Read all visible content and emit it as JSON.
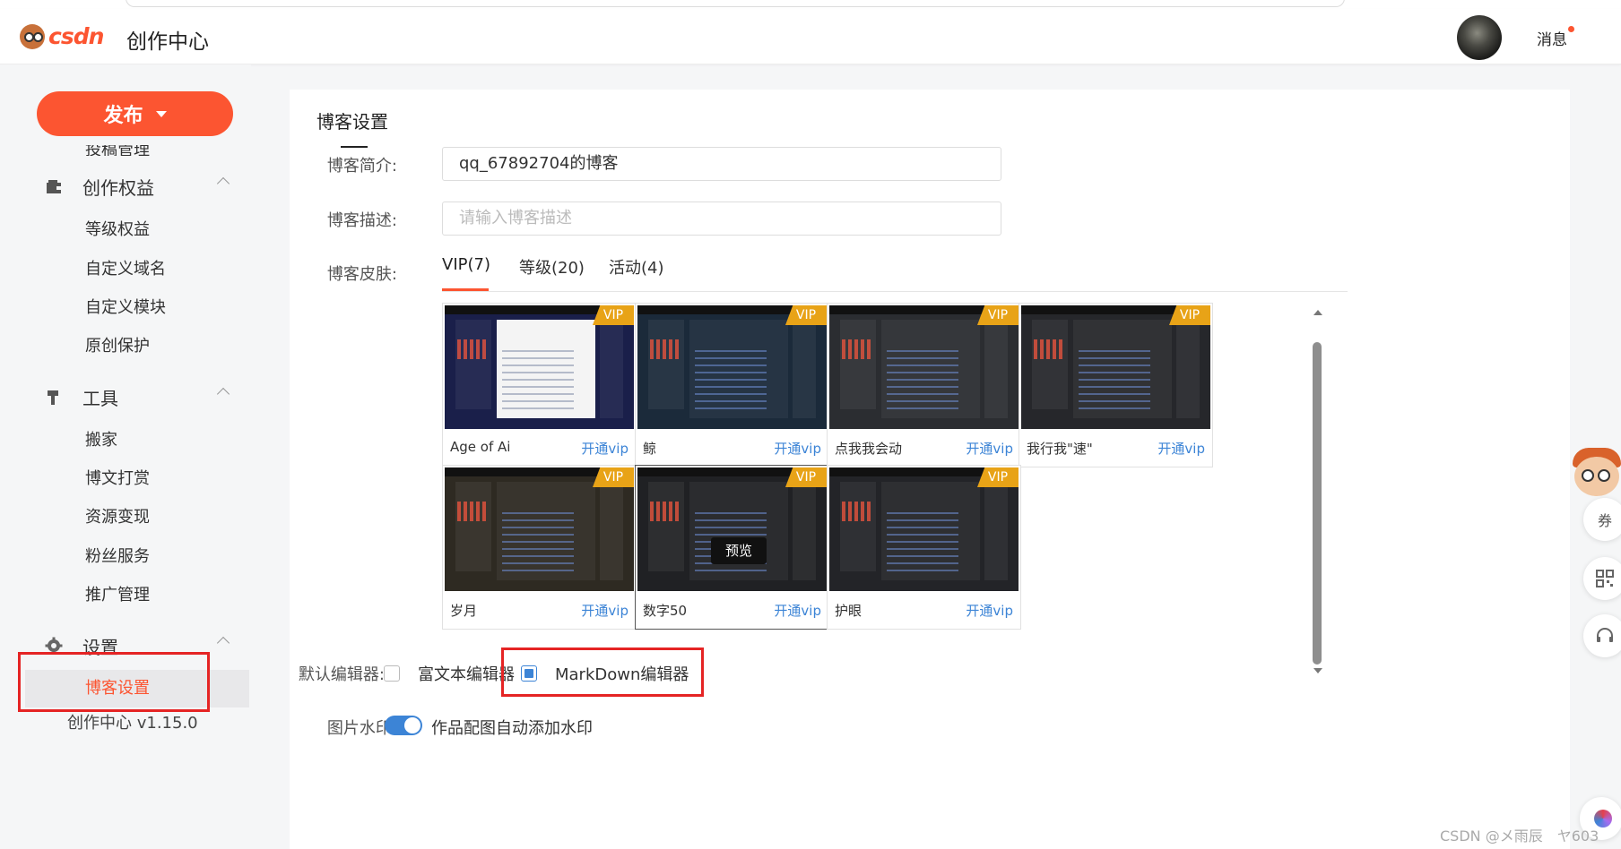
{
  "header": {
    "logo_text": "csdn",
    "title": "创作中心",
    "messages_label": "消息"
  },
  "sidebar": {
    "publish_label": "发布",
    "cut_item": "投稿管理",
    "groups": [
      {
        "title": "创作权益",
        "icon": "wallet-icon",
        "items": [
          "等级权益",
          "自定义域名",
          "自定义模块",
          "原创保护"
        ]
      },
      {
        "title": "工具",
        "icon": "tool-icon",
        "items": [
          "搬家",
          "博文打赏",
          "资源变现",
          "粉丝服务",
          "推广管理"
        ]
      },
      {
        "title": "设置",
        "icon": "gear-icon",
        "items": [
          "博客设置"
        ]
      }
    ],
    "active_item": "博客设置",
    "version": "创作中心 v1.15.0"
  },
  "panel": {
    "title": "博客设置",
    "intro_label": "博客简介:",
    "intro_value": "qq_67892704的博客",
    "desc_label": "博客描述:",
    "desc_placeholder": "请输入博客描述",
    "skin_label": "博客皮肤:",
    "tabs": [
      "VIP(7)",
      "等级(20)",
      "活动(4)"
    ],
    "skins": [
      {
        "name": "Age of Ai",
        "action": "开通vip",
        "badge": "VIP"
      },
      {
        "name": "鲸",
        "action": "开通vip",
        "badge": "VIP"
      },
      {
        "name": "点我我会动",
        "action": "开通vip",
        "badge": "VIP"
      },
      {
        "name": "我行我\"速\"",
        "action": "开通vip",
        "badge": "VIP"
      },
      {
        "name": "岁月",
        "action": "开通vip",
        "badge": "VIP"
      },
      {
        "name": "数字50",
        "action": "开通vip",
        "badge": "VIP",
        "preview": "预览"
      },
      {
        "name": "护眼",
        "action": "开通vip",
        "badge": "VIP"
      }
    ],
    "editor_label": "默认编辑器:",
    "editor_options": [
      "富文本编辑器",
      "MarkDown编辑器"
    ],
    "editor_selected": "MarkDown编辑器",
    "watermark_label": "图片水印:",
    "watermark_toggle_label": "作品配图自动添加水印",
    "watermark_on": true
  },
  "float_tools": {
    "coupon_label": "券",
    "qr_icon": "qrcode-icon",
    "service_icon": "headset-icon"
  },
  "watermark_text": "CSDN @メ雨辰　ヤ603",
  "colors": {
    "accent": "#fc5531",
    "link": "#3c84d6",
    "vip": "#e8a317",
    "highlight_box": "#e52424"
  }
}
